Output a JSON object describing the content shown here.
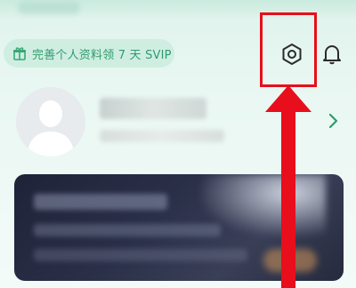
{
  "header": {
    "vip_banner": {
      "text": "完善个人资料领 7 天 SVIP",
      "icon": "gift-icon"
    },
    "actions": [
      {
        "name": "settings",
        "icon": "settings-hexagon-icon"
      },
      {
        "name": "notifications",
        "icon": "bell-icon"
      }
    ]
  },
  "profile": {
    "avatar_icon": "default-avatar-icon",
    "chevron_icon": "chevron-right-icon"
  },
  "annotation": {
    "highlight_color": "#e80e1b",
    "arrow_icon": "up-arrow-icon"
  },
  "colors": {
    "accent_green": "#2f9b6e",
    "pill_bg": "#cfeee1",
    "background": "#e9f7f2"
  }
}
